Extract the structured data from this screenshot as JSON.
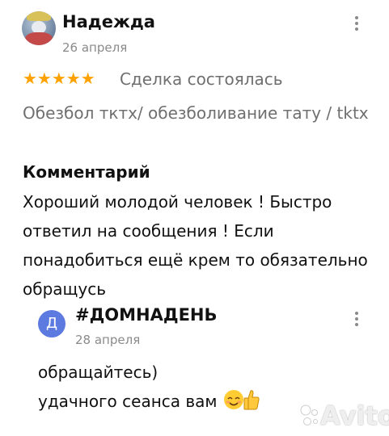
{
  "review": {
    "author": "Надежда",
    "date": "26 апреля",
    "rating": 5,
    "stars": "★★★★★",
    "status": "Сделка состоялась",
    "service": "Обезбол тктх/ обезболивание тату / tktx",
    "comment_heading": "Комментарий",
    "comment": "Хороший молодой человек ! Быстро ответил на сообщения ! Если понадобиться ещё крем то обязательно обращусь"
  },
  "reply": {
    "avatar_letter": "Д",
    "author": "#ДОМНАДЕНЬ",
    "date": "28 апреля",
    "line1": "обращайтесь)",
    "line2": "удачного сеанса вам"
  },
  "watermark": "Avito",
  "colors": {
    "star": "#ffa200",
    "reply_avatar": "#5c7ae0"
  },
  "icons": [
    "kebab-menu-icon",
    "smiling-face-emoji",
    "thumbs-up-emoji",
    "avito-logo"
  ]
}
